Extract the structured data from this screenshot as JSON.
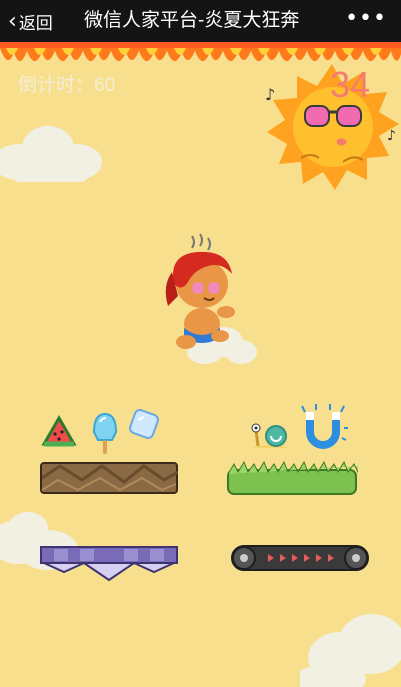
{
  "nav": {
    "back_label": "返回",
    "title": "微信人家平台-炎夏大狂奔",
    "more_label": "•••"
  },
  "game": {
    "countdown_label": "倒计时：",
    "countdown_value": "60",
    "score": "34",
    "left_items": [
      "watermelon",
      "popsicle",
      "ice-cube"
    ],
    "right_items": [
      "snail",
      "magnet"
    ],
    "platforms_row1": [
      "brown-rock-platform",
      "grass-platform"
    ],
    "platforms_row2": [
      "purple-spike-platform",
      "conveyor-belt-platform"
    ]
  },
  "colors": {
    "background": "#f7df8e",
    "nav_background": "#141414",
    "score_color": "#f57b6f",
    "timer_color": "#f3eed8"
  }
}
